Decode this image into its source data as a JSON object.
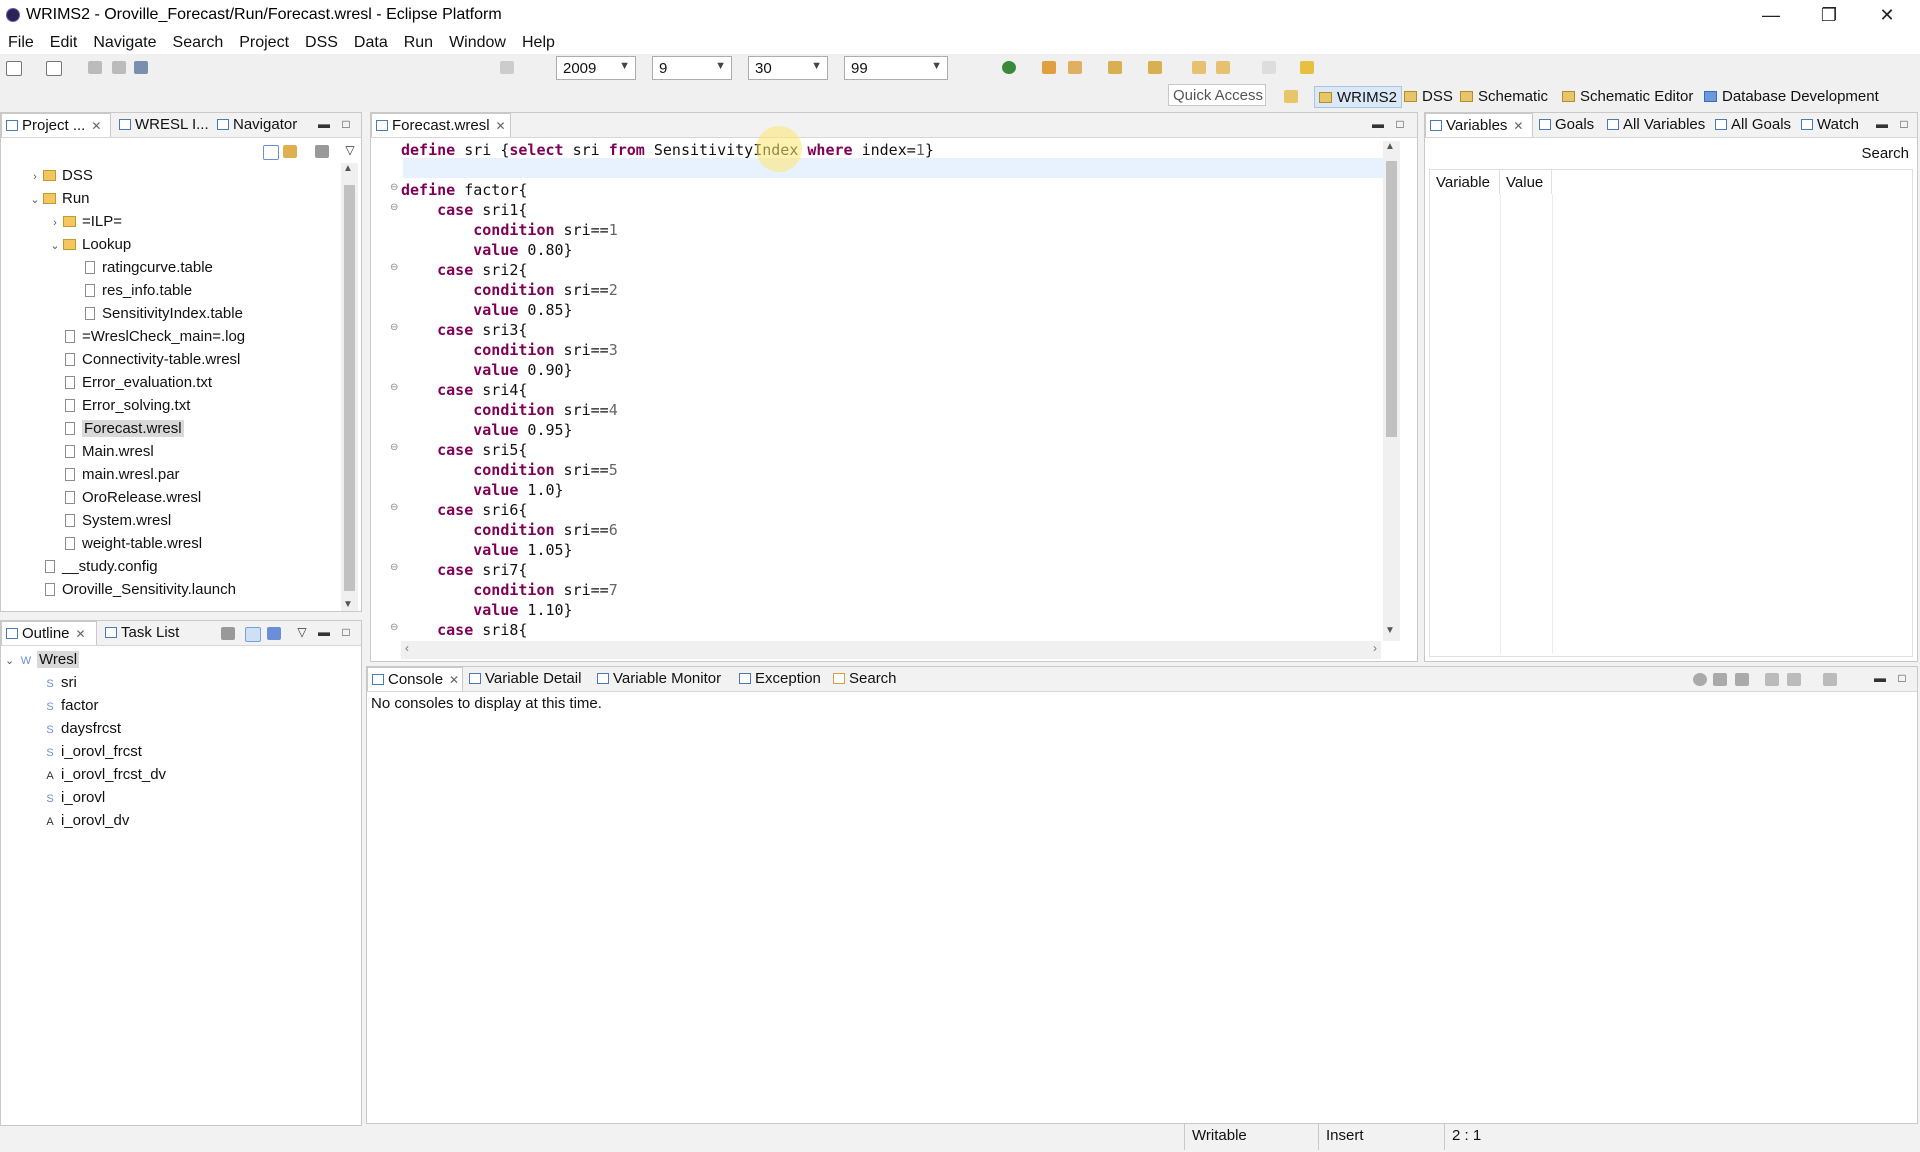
{
  "window": {
    "title": "WRIMS2 - Oroville_Forecast/Run/Forecast.wresl - Eclipse Platform",
    "controls": {
      "minimize": "—",
      "restore": "❐",
      "close": "✕"
    }
  },
  "menu": [
    "File",
    "Edit",
    "Navigate",
    "Search",
    "Project",
    "DSS",
    "Data",
    "Run",
    "Window",
    "Help"
  ],
  "toolbar": {
    "year": "2009",
    "month": "9",
    "day": "30",
    "cycle": "99"
  },
  "perspective_bar": {
    "quick_access": "Quick Access",
    "perspectives": [
      "WRIMS2",
      "DSS",
      "Schematic",
      "Schematic Editor",
      "Database Development"
    ],
    "active": "WRIMS2"
  },
  "project_panel": {
    "tabs": [
      "Project ...",
      "WRESL I...",
      "Navigator"
    ],
    "tree": [
      {
        "label": "DSS",
        "type": "folder",
        "depth": 0,
        "expanded": false
      },
      {
        "label": "Run",
        "type": "folder",
        "depth": 0,
        "expanded": true
      },
      {
        "label": "=ILP=",
        "type": "folder",
        "depth": 1,
        "expanded": false
      },
      {
        "label": "Lookup",
        "type": "folder",
        "depth": 1,
        "expanded": true
      },
      {
        "label": "ratingcurve.table",
        "type": "file",
        "depth": 2
      },
      {
        "label": "res_info.table",
        "type": "file",
        "depth": 2
      },
      {
        "label": "SensitivityIndex.table",
        "type": "file",
        "depth": 2
      },
      {
        "label": "=WreslCheck_main=.log",
        "type": "file",
        "depth": 1
      },
      {
        "label": "Connectivity-table.wresl",
        "type": "file",
        "depth": 1
      },
      {
        "label": "Error_evaluation.txt",
        "type": "file",
        "depth": 1
      },
      {
        "label": "Error_solving.txt",
        "type": "file",
        "depth": 1
      },
      {
        "label": "Forecast.wresl",
        "type": "file",
        "depth": 1,
        "selected": true
      },
      {
        "label": "Main.wresl",
        "type": "file",
        "depth": 1
      },
      {
        "label": "main.wresl.par",
        "type": "file",
        "depth": 1
      },
      {
        "label": "OroRelease.wresl",
        "type": "file",
        "depth": 1
      },
      {
        "label": "System.wresl",
        "type": "file",
        "depth": 1
      },
      {
        "label": "weight-table.wresl",
        "type": "file",
        "depth": 1
      },
      {
        "label": "__study.config",
        "type": "file",
        "depth": 0
      },
      {
        "label": "Oroville_Sensitivity.launch",
        "type": "file",
        "depth": 0
      }
    ]
  },
  "outline_panel": {
    "tabs": [
      "Outline",
      "Task List"
    ],
    "root": "Wresl",
    "items": [
      {
        "badge": "S",
        "label": "sri"
      },
      {
        "badge": "S",
        "label": "factor"
      },
      {
        "badge": "S",
        "label": "daysfrcst"
      },
      {
        "badge": "S",
        "label": "i_orovl_frcst"
      },
      {
        "badge": "A",
        "label": "i_orovl_frcst_dv"
      },
      {
        "badge": "S",
        "label": "i_orovl"
      },
      {
        "badge": "A",
        "label": "i_orovl_dv"
      }
    ]
  },
  "editor": {
    "tab": "Forecast.wresl",
    "lines": [
      {
        "parts": [
          [
            "kw",
            "define"
          ],
          [
            "t",
            " sri {"
          ],
          [
            "kw",
            "select"
          ],
          [
            "t",
            " sri "
          ],
          [
            "kw",
            "from"
          ],
          [
            "t",
            " SensitivityIndex "
          ],
          [
            "kw",
            "where"
          ],
          [
            "t",
            " index="
          ],
          [
            "num",
            "1"
          ],
          [
            "t",
            "}"
          ]
        ]
      },
      {
        "parts": []
      },
      {
        "parts": [
          [
            "kw",
            "define"
          ],
          [
            "t",
            " factor{"
          ]
        ],
        "fold": true
      },
      {
        "parts": [
          [
            "t",
            "    "
          ],
          [
            "kw",
            "case"
          ],
          [
            "t",
            " sri1{"
          ]
        ],
        "fold": true
      },
      {
        "parts": [
          [
            "t",
            "        "
          ],
          [
            "kw",
            "condition"
          ],
          [
            "t",
            " sri=="
          ],
          [
            "num",
            "1"
          ]
        ]
      },
      {
        "parts": [
          [
            "t",
            "        "
          ],
          [
            "kw",
            "value"
          ],
          [
            "t",
            " 0.80}"
          ]
        ]
      },
      {
        "parts": [
          [
            "t",
            "    "
          ],
          [
            "kw",
            "case"
          ],
          [
            "t",
            " sri2{"
          ]
        ],
        "fold": true
      },
      {
        "parts": [
          [
            "t",
            "        "
          ],
          [
            "kw",
            "condition"
          ],
          [
            "t",
            " sri=="
          ],
          [
            "num",
            "2"
          ]
        ]
      },
      {
        "parts": [
          [
            "t",
            "        "
          ],
          [
            "kw",
            "value"
          ],
          [
            "t",
            " 0.85}"
          ]
        ]
      },
      {
        "parts": [
          [
            "t",
            "    "
          ],
          [
            "kw",
            "case"
          ],
          [
            "t",
            " sri3{"
          ]
        ],
        "fold": true
      },
      {
        "parts": [
          [
            "t",
            "        "
          ],
          [
            "kw",
            "condition"
          ],
          [
            "t",
            " sri=="
          ],
          [
            "num",
            "3"
          ]
        ]
      },
      {
        "parts": [
          [
            "t",
            "        "
          ],
          [
            "kw",
            "value"
          ],
          [
            "t",
            " 0.90}"
          ]
        ]
      },
      {
        "parts": [
          [
            "t",
            "    "
          ],
          [
            "kw",
            "case"
          ],
          [
            "t",
            " sri4{"
          ]
        ],
        "fold": true
      },
      {
        "parts": [
          [
            "t",
            "        "
          ],
          [
            "kw",
            "condition"
          ],
          [
            "t",
            " sri=="
          ],
          [
            "num",
            "4"
          ]
        ]
      },
      {
        "parts": [
          [
            "t",
            "        "
          ],
          [
            "kw",
            "value"
          ],
          [
            "t",
            " 0.95}"
          ]
        ]
      },
      {
        "parts": [
          [
            "t",
            "    "
          ],
          [
            "kw",
            "case"
          ],
          [
            "t",
            " sri5{"
          ]
        ],
        "fold": true
      },
      {
        "parts": [
          [
            "t",
            "        "
          ],
          [
            "kw",
            "condition"
          ],
          [
            "t",
            " sri=="
          ],
          [
            "num",
            "5"
          ]
        ]
      },
      {
        "parts": [
          [
            "t",
            "        "
          ],
          [
            "kw",
            "value"
          ],
          [
            "t",
            " 1.0}"
          ]
        ]
      },
      {
        "parts": [
          [
            "t",
            "    "
          ],
          [
            "kw",
            "case"
          ],
          [
            "t",
            " sri6{"
          ]
        ],
        "fold": true
      },
      {
        "parts": [
          [
            "t",
            "        "
          ],
          [
            "kw",
            "condition"
          ],
          [
            "t",
            " sri=="
          ],
          [
            "num",
            "6"
          ]
        ]
      },
      {
        "parts": [
          [
            "t",
            "        "
          ],
          [
            "kw",
            "value"
          ],
          [
            "t",
            " 1.05}"
          ]
        ]
      },
      {
        "parts": [
          [
            "t",
            "    "
          ],
          [
            "kw",
            "case"
          ],
          [
            "t",
            " sri7{"
          ]
        ],
        "fold": true
      },
      {
        "parts": [
          [
            "t",
            "        "
          ],
          [
            "kw",
            "condition"
          ],
          [
            "t",
            " sri=="
          ],
          [
            "num",
            "7"
          ]
        ]
      },
      {
        "parts": [
          [
            "t",
            "        "
          ],
          [
            "kw",
            "value"
          ],
          [
            "t",
            " 1.10}"
          ]
        ]
      },
      {
        "parts": [
          [
            "t",
            "    "
          ],
          [
            "kw",
            "case"
          ],
          [
            "t",
            " sri8{"
          ]
        ],
        "fold": true
      }
    ]
  },
  "variables_panel": {
    "tabs": [
      "Variables",
      "Goals",
      "All Variables",
      "All Goals",
      "Watch"
    ],
    "search": "Search",
    "columns": [
      "Variable",
      "Value"
    ]
  },
  "console_panel": {
    "tabs": [
      "Console",
      "Variable Detail",
      "Variable Monitor",
      "Exception",
      "Search"
    ],
    "message": "No consoles to display at this time."
  },
  "status_bar": {
    "mode": "Writable",
    "insert": "Insert",
    "position": "2 : 1"
  },
  "colors": {
    "keyword": "#7f0055",
    "number": "#666666",
    "selection": "#d9d9d9",
    "current_line": "#e8f2fe"
  }
}
